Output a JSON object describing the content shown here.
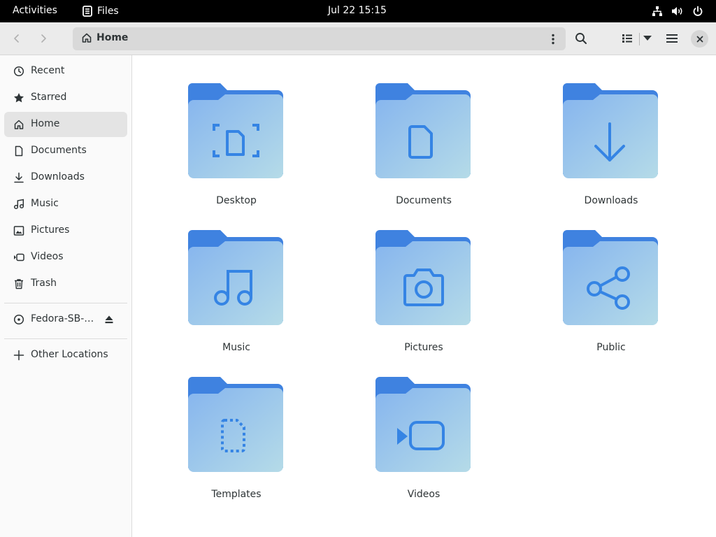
{
  "topbar": {
    "activities": "Activities",
    "app_name": "Files",
    "clock": "Jul 22  15:15"
  },
  "headerbar": {
    "path_home": "Home"
  },
  "sidebar": {
    "items": [
      {
        "label": "Recent",
        "icon": "clock-icon"
      },
      {
        "label": "Starred",
        "icon": "star-icon"
      },
      {
        "label": "Home",
        "icon": "home-icon"
      },
      {
        "label": "Documents",
        "icon": "document-icon"
      },
      {
        "label": "Downloads",
        "icon": "download-icon"
      },
      {
        "label": "Music",
        "icon": "music-icon"
      },
      {
        "label": "Pictures",
        "icon": "picture-icon"
      },
      {
        "label": "Videos",
        "icon": "video-icon"
      },
      {
        "label": "Trash",
        "icon": "trash-icon"
      }
    ],
    "drive": {
      "label": "Fedora-SB-…",
      "icon": "disc-icon"
    },
    "other": {
      "label": "Other Locations",
      "icon": "plus-icon"
    }
  },
  "folders": [
    {
      "label": "Desktop",
      "icon": "desktop-emblem-icon"
    },
    {
      "label": "Documents",
      "icon": "document-emblem-icon"
    },
    {
      "label": "Downloads",
      "icon": "download-emblem-icon"
    },
    {
      "label": "Music",
      "icon": "music-emblem-icon"
    },
    {
      "label": "Pictures",
      "icon": "camera-emblem-icon"
    },
    {
      "label": "Public",
      "icon": "share-emblem-icon"
    },
    {
      "label": "Templates",
      "icon": "template-emblem-icon"
    },
    {
      "label": "Videos",
      "icon": "video-emblem-icon"
    }
  ],
  "colors": {
    "folder_back": "#3f82e0",
    "folder_front_top": "#86b5ee",
    "folder_front_bottom": "#b5dbe8",
    "emblem": "#3584e4",
    "selected_row": "#e4e4e4"
  }
}
